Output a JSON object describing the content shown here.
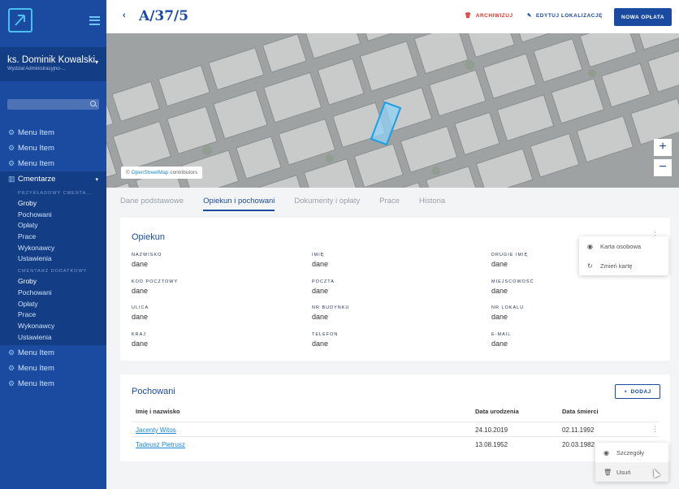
{
  "sidebar": {
    "user_name": "ks. Dominik Kowalski",
    "user_dept": "Wydział Administracyjno-...",
    "menu_top": [
      {
        "label": "Menu Item"
      },
      {
        "label": "Menu Item"
      },
      {
        "label": "Menu Item"
      }
    ],
    "cmentarze_label": "Cmentarze",
    "group1_heading": "PRZYKŁADOWY CMENTA...",
    "group1_items": [
      "Groby",
      "Pochowani",
      "Opłaty",
      "Prace",
      "Wykonawcy",
      "Ustawienia"
    ],
    "group2_heading": "CMENTARZ DODATKOWY",
    "group2_items": [
      "Groby",
      "Pochowani",
      "Opłaty",
      "Prace",
      "Wykonawcy",
      "Ustawienia"
    ],
    "menu_bottom": [
      {
        "label": "Menu Item"
      },
      {
        "label": "Menu Item"
      },
      {
        "label": "Menu Item"
      }
    ]
  },
  "header": {
    "title": "A/37/5",
    "archive_label": "ARCHIWIZUJ",
    "edit_label": "EDYTUJ LOKALIZACJĘ",
    "new_label": "NOWA OPŁATA"
  },
  "map": {
    "attribution_prefix": "©",
    "attribution_link": "OpenStreetMap",
    "attribution_suffix": "contributors",
    "zoom_in": "+",
    "zoom_out": "−"
  },
  "tabs": [
    "Dane podstawowe",
    "Opiekun i pochowani",
    "Dokumenty i opłaty",
    "Prace",
    "Historia"
  ],
  "opiekun": {
    "title": "Opiekun",
    "fields": [
      {
        "label": "NAZWISKO",
        "value": "dane"
      },
      {
        "label": "IMIĘ",
        "value": "dane"
      },
      {
        "label": "DRUGIE IMIĘ",
        "value": "dane"
      },
      {
        "label": "KOD POCZTOWY",
        "value": "dane"
      },
      {
        "label": "POCZTA",
        "value": "dane"
      },
      {
        "label": "MIEJSCOWOŚĆ",
        "value": "dane"
      },
      {
        "label": "ULICA",
        "value": "dane"
      },
      {
        "label": "NR BUDYNKU",
        "value": "dane"
      },
      {
        "label": "NR LOKALU",
        "value": "dane"
      },
      {
        "label": "KRAJ",
        "value": "dane"
      },
      {
        "label": "TELEFON",
        "value": "dane"
      },
      {
        "label": "E-MAIL",
        "value": "dane"
      }
    ],
    "menu": [
      "Karta osobowa",
      "Zmień kartę"
    ]
  },
  "pochowani": {
    "title": "Pochowani",
    "add_label": "DODAJ",
    "headers": [
      "Imię i nazwisko",
      "Data urodzenia",
      "Data śmierci"
    ],
    "rows": [
      {
        "name": "Jacenty Witos",
        "born": "24.10.2019",
        "died": "02.11.1992"
      },
      {
        "name": "Tadeusz Pietrusz",
        "born": "13.08.1952",
        "died": "20.03.1982"
      }
    ],
    "row_menu": [
      "Szczegóły",
      "Usuń"
    ]
  }
}
